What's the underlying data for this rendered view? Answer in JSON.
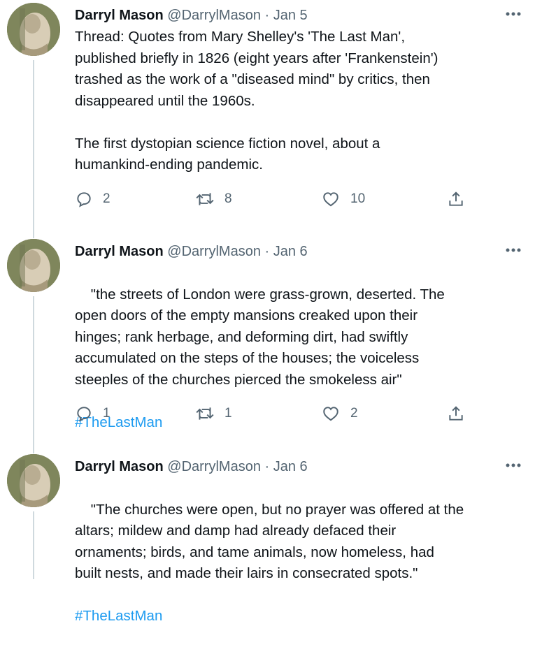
{
  "tweets": [
    {
      "author_name": "Darryl Mason",
      "handle": "@DarrylMason",
      "separator": "·",
      "date": "Jan 5",
      "text": "Thread: Quotes from Mary Shelley's 'The Last Man',\npublished briefly in 1826 (eight years after 'Frankenstein')\ntrashed as the work of a \"diseased mind\" by critics, then\ndisappeared until the 1960s.\n\nThe first dystopian science fiction novel, about a\nhumankind-ending pandemic.",
      "hashtag": "",
      "replies": "2",
      "retweets": "8",
      "likes": "10"
    },
    {
      "author_name": "Darryl Mason",
      "handle": "@DarrylMason",
      "separator": "·",
      "date": "Jan 6",
      "text": "\"the streets of London were grass-grown, deserted. The\nopen doors of the empty mansions creaked upon their\nhinges; rank herbage, and deforming dirt, had swiftly\naccumulated on the steps of the houses; the voiceless\nsteeples of the churches pierced the smokeless air\"",
      "hashtag": "#TheLastMan",
      "replies": "1",
      "retweets": "1",
      "likes": "2"
    },
    {
      "author_name": "Darryl Mason",
      "handle": "@DarrylMason",
      "separator": "·",
      "date": "Jan 6",
      "text": "\"The churches were open, but no prayer was offered at the\naltars; mildew and damp had already defaced their\nornaments; birds, and tame animals, now homeless, had\nbuilt nests, and made their lairs in consecrated spots.\"",
      "hashtag": "#TheLastMan"
    }
  ],
  "icons": {
    "reply": "reply-icon",
    "retweet": "retweet-icon",
    "like": "heart-icon",
    "share": "share-icon",
    "more": "more-icon"
  },
  "colors": {
    "text": "#0f1419",
    "secondary": "#536471",
    "link": "#1d9bf0",
    "thread_line": "#cfd9de"
  }
}
